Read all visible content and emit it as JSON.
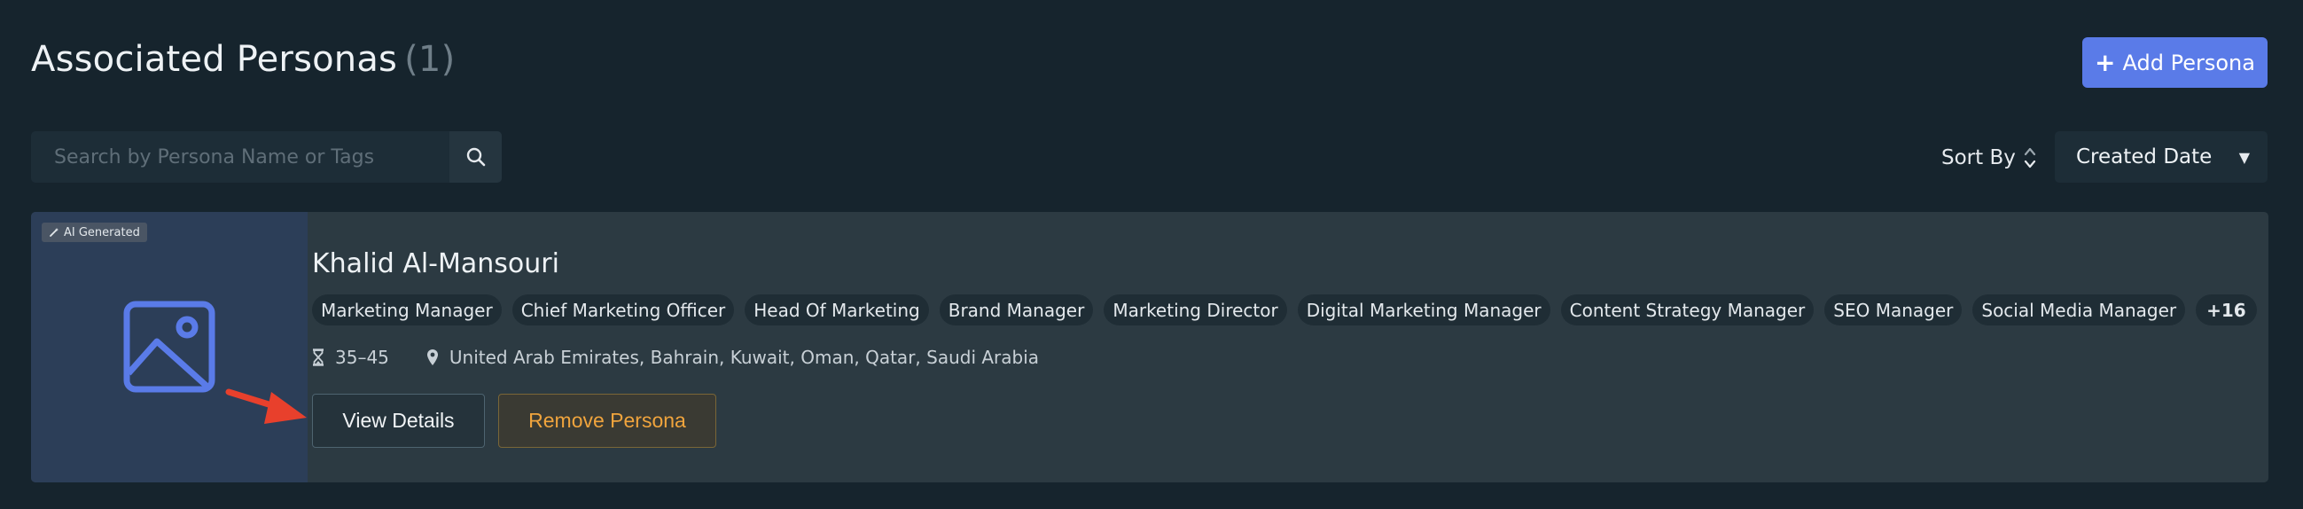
{
  "header": {
    "title": "Associated Personas",
    "count": "(1)",
    "add_button_label": "Add Persona"
  },
  "search": {
    "placeholder": "Search by Persona Name or Tags",
    "value": ""
  },
  "sort": {
    "label": "Sort By",
    "selected": "Created Date"
  },
  "persona": {
    "badge": "AI Generated",
    "name": "Khalid Al-Mansouri",
    "tags": [
      "Marketing Manager",
      "Chief Marketing Officer",
      "Head Of Marketing",
      "Brand Manager",
      "Marketing Director",
      "Digital Marketing Manager",
      "Content Strategy Manager",
      "SEO Manager",
      "Social Media Manager"
    ],
    "more_tags": "+16",
    "age_range": "35–45",
    "locations": "United Arab Emirates, Bahrain, Kuwait, Oman, Qatar, Saudi Arabia",
    "view_button_label": "View Details",
    "remove_button_label": "Remove Persona"
  },
  "icons": {
    "add": "plus-icon",
    "search": "search-icon",
    "sort": "sort-arrows-icon",
    "dropdown": "caret-down-icon",
    "badge": "wand-icon",
    "thumbnail": "image-placeholder-icon",
    "age": "hourglass-icon",
    "location": "map-pin-icon",
    "annotation": "red-arrow-icon"
  },
  "colors": {
    "background": "#16242d",
    "card": "#2c3a42",
    "thumbnail": "#2c3e58",
    "accent": "#5a7be8",
    "remove": "#f0a43d",
    "arrow": "#e8402c"
  }
}
